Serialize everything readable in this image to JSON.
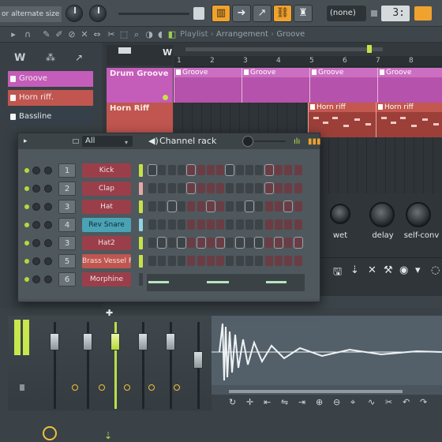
{
  "topbar": {
    "hint_text": "or alternate size",
    "pattern_select": "(none)",
    "pattern_number": "3:"
  },
  "playlist": {
    "title_prefix": "Playlist",
    "title_arrangement": "Arrangement",
    "title_pattern": "Groove",
    "ruler_numbers": [
      "1",
      "2",
      "3",
      "4",
      "5",
      "6",
      "7",
      "8"
    ],
    "tracks": [
      {
        "name": "Drum Groove",
        "clip": "Groove",
        "color": "#c45cb9"
      },
      {
        "name": "Horn Riff",
        "clip": "Horn riff",
        "color": "#c0564f"
      }
    ]
  },
  "browser": {
    "patterns": [
      {
        "label": "Groove",
        "color": "#c45cb9"
      },
      {
        "label": "Horn riff.",
        "color": "#c0564f"
      },
      {
        "label": "Bassline",
        "color": "#36404a"
      }
    ]
  },
  "channel_rack": {
    "filter": "All",
    "title": "Channel rack",
    "channels": [
      {
        "num": "1",
        "name": "Kick",
        "color": "#9a3f4a",
        "ind": "#c6e24a"
      },
      {
        "num": "2",
        "name": "Clap",
        "color": "#9a3f4a",
        "ind": "#e6a7a5"
      },
      {
        "num": "3",
        "name": "Hat",
        "color": "#9a3f4a",
        "ind": "#c6e24a"
      },
      {
        "num": "4",
        "name": "Rev Snare",
        "color": "#4aa3b4",
        "ind": "#8fd4e0"
      },
      {
        "num": "3",
        "name": "Hat2",
        "color": "#9a3f4a",
        "ind": "#c6e24a"
      },
      {
        "num": "5",
        "name": "Brass Vessel FG",
        "color": "#c0564f",
        "ind": "#c6e24a"
      },
      {
        "num": "6",
        "name": "Morphine",
        "color": "#9a3f4a",
        "ind": "#3b4246"
      }
    ]
  },
  "effects": {
    "wet": "wet",
    "delay": "delay",
    "self_conv": "self-conv"
  },
  "colors": {
    "accent_orange": "#f0a22e",
    "meter_green": "#c8e84c"
  }
}
